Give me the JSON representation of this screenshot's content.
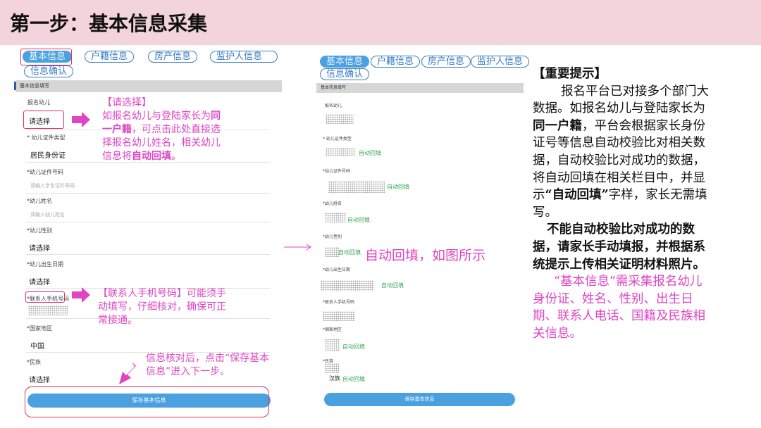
{
  "header": {
    "title": "第一步：基本信息采集"
  },
  "left_form": {
    "tabs": [
      "基本信息",
      "户籍信息",
      "房产信息",
      "监护人信息",
      "信息确认"
    ],
    "section": "基本信息填写",
    "fields": {
      "child_name_label": "报名幼儿",
      "child_name_value": "请选择",
      "id_type_label": "* 幼儿证件类型",
      "id_type_value": "居民身份证",
      "id_no_label": "*幼儿证件号码",
      "id_no_placeholder": "请输入学生证件号码",
      "name_label": "*幼儿姓名",
      "name_placeholder": "请输入幼儿姓名",
      "gender_label": "*幼儿性别",
      "gender_value": "请选择",
      "birth_label": "*幼儿出生日期",
      "birth_value": "请选择",
      "phone_label": "*联系人手机号码",
      "country_label": "*国家地区",
      "country_value": "中国",
      "ethnic_label": "*民族",
      "ethnic_value": "请选择"
    },
    "save_label": "保存基本信息"
  },
  "annotations": {
    "a1_title": "【请选择】",
    "a1_line1_pre": "如报名幼儿与登陆家长为",
    "a1_line1_bold": "同",
    "a1_line2_bold": "一户籍",
    "a1_line2_post": "，可点击此处直接选",
    "a1_line3": "择报名幼儿姓名，相关幼儿",
    "a1_line4_pre": "信息将",
    "a1_line4_bold": "自动回填",
    "a1_line4_post": "。",
    "a2_line1": "【联系人手机号码】可能须手",
    "a2_line2": "动填写，仔细核对，确保可正",
    "a2_line3": "常接通。",
    "a3_line1": "信息核对后，点击“保存基本",
    "a3_line2": "信息”进入下一步。",
    "middle": "自动回填，如图所示"
  },
  "right_form": {
    "tabs": [
      "基本信息",
      "户籍信息",
      "房产信息",
      "监护人信息",
      "信息确认"
    ],
    "section": "基本信息填写",
    "child_name_label": "报名幼儿",
    "id_type_label": "* 幼儿证件类型",
    "id_no_label": "*幼儿证件号码",
    "name_label": "*幼儿姓名",
    "gender_label": "*幼儿性别",
    "birth_label": "*幼儿出生日期",
    "phone_label": "*联系人手机号码",
    "country_label": "*国家地区",
    "ethnic_label": "*民族",
    "ethnic_value": "汉族",
    "auto_label": "自动回填",
    "save_label": "保存基本信息"
  },
  "note": {
    "title": "【重要提示】",
    "p1_a": "报名平台已对接多个部门大数据。如报名幼儿与登陆家长为",
    "p1_bold1": "同一户籍",
    "p1_b": "，平台会根据家长身份证号等信息自动校验比对相关数据，自动校验比对成功的数据，将自动回填在相关栏目中，并显示",
    "p1_bold2": "“自动回填”",
    "p1_c": "字样，家长无需填写。",
    "p2": "不能自动校验比对成功的数据，请家长手动填报，并根据系统提示上传相关证明材料照片。",
    "p3": "“基本信息”需采集报名幼儿身份证、姓名、性别、出生日期、联系人电话、国籍及民族相关信息。"
  },
  "colors": {
    "header_bg": "#f3d3dc",
    "accent_pink": "#e044c4",
    "tab_blue": "#3a7cc4",
    "auto_green": "#3aa855"
  }
}
